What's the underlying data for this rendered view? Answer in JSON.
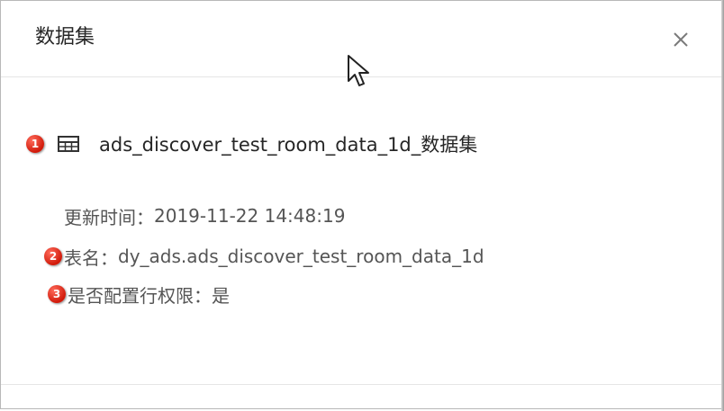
{
  "dialog": {
    "title": "数据集",
    "close_icon": "close-icon"
  },
  "dataset": {
    "annotation": "1",
    "icon": "table-icon",
    "name": "ads_discover_test_room_data_1d_数据集"
  },
  "info": {
    "update_time_label": "更新时间：",
    "update_time_value": "2019-11-22 14:48:19",
    "table_name_annotation": "2",
    "table_name_label": "表名：",
    "table_name_value": "dy_ads.ads_discover_test_room_data_1d",
    "row_permission_annotation": "3",
    "row_permission_label": "是否配置行权限：",
    "row_permission_value": "是"
  },
  "colors": {
    "badge": "#d11a0a",
    "text": "#555555",
    "title": "#262626"
  }
}
